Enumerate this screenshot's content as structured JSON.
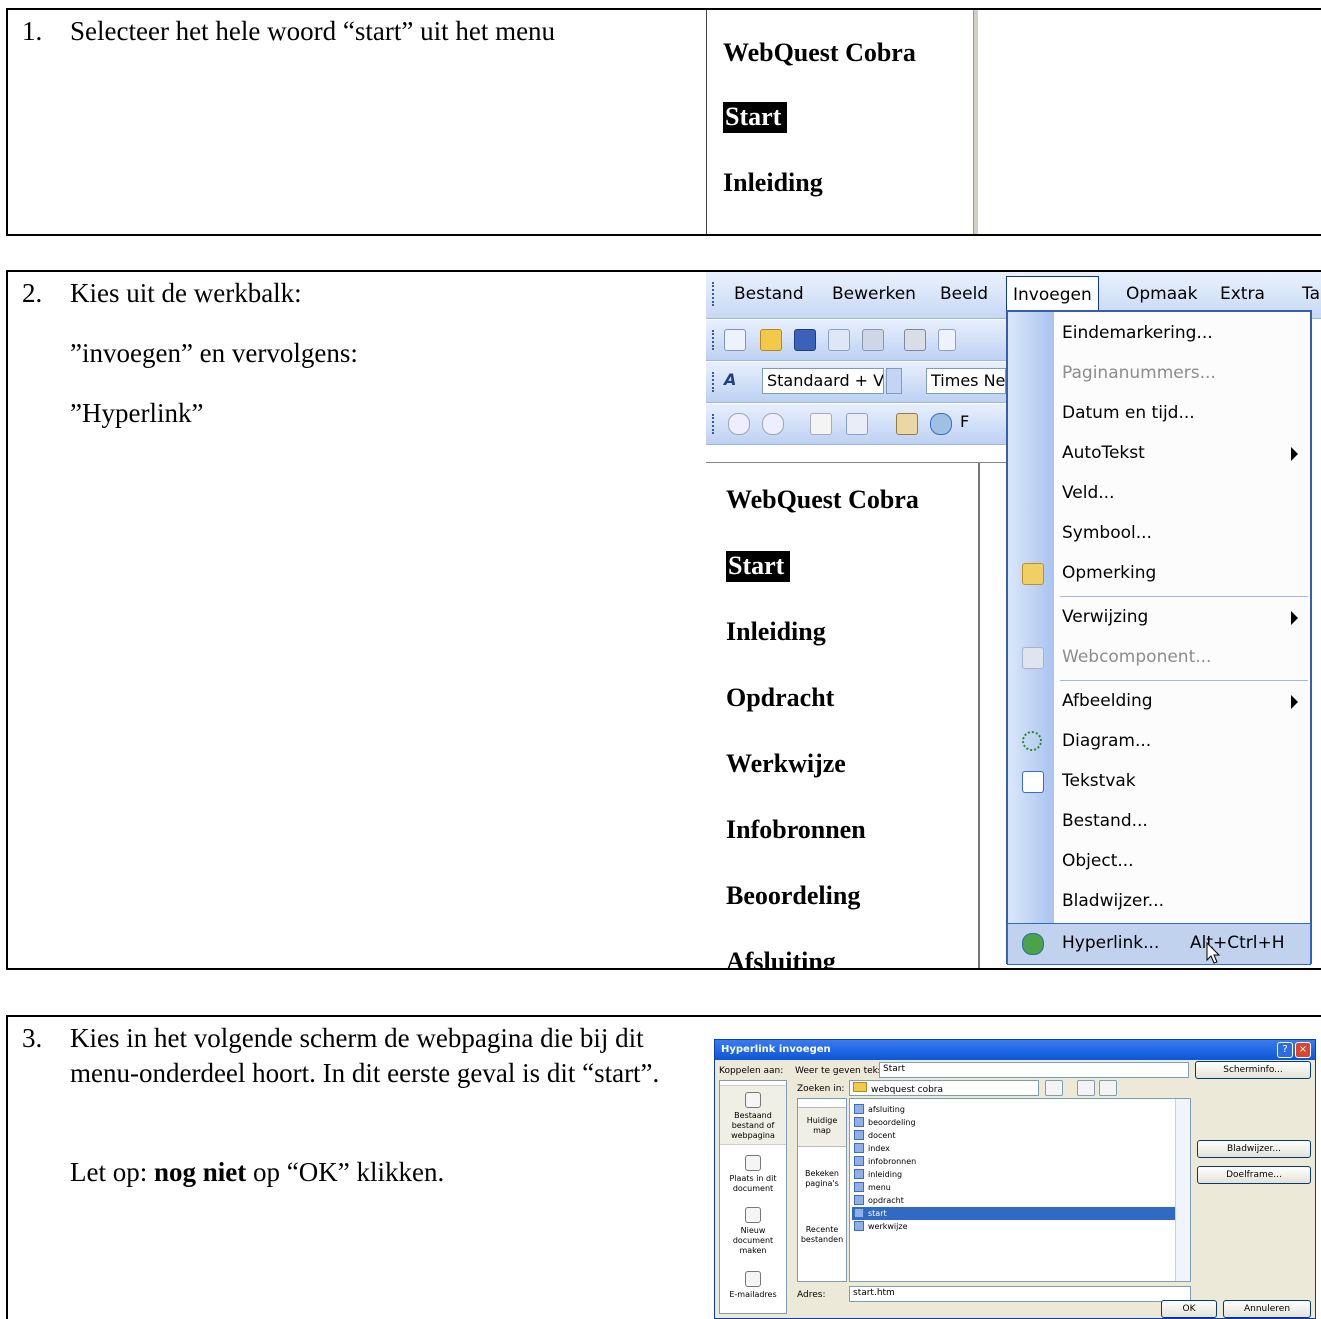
{
  "step1": {
    "number": "1.",
    "instruction": "Selecteer het hele woord “start” uit het menu",
    "menu_items": [
      "WebQuest Cobra",
      "Start",
      "Inleiding"
    ]
  },
  "step2": {
    "number": "2.",
    "line1": "Kies uit de werkbalk:",
    "line2": "”invoegen” en vervolgens:",
    "line3": "”Hyperlink”",
    "menubar": [
      "Bestand",
      "Bewerken",
      "Beeld",
      "Invoegen",
      "Opmaak",
      "Extra",
      "Ta"
    ],
    "style_box": "Standaard + Ve",
    "font_box": "Times Ne",
    "toolbar_letter": "F",
    "doc_items": [
      "WebQuest Cobra",
      "Start",
      "Inleiding",
      "Opdracht",
      "Werkwijze",
      "Infobronnen",
      "Beoordeling",
      "Afsluiting"
    ],
    "dropdown": [
      {
        "label": "Eindemarkering...",
        "disabled": false
      },
      {
        "label": "Paginanummers...",
        "disabled": true
      },
      {
        "label": "Datum en tijd...",
        "disabled": false
      },
      {
        "label": "AutoTekst",
        "disabled": false,
        "submenu": true
      },
      {
        "label": "Veld...",
        "disabled": false
      },
      {
        "label": "Symbool...",
        "disabled": false
      },
      {
        "label": "Opmerking",
        "disabled": false,
        "icon": "comment-icon"
      },
      {
        "label": "Verwijzing",
        "disabled": false,
        "submenu": true
      },
      {
        "label": "Webcomponent...",
        "disabled": true,
        "icon": "web-component-icon"
      },
      {
        "label": "Afbeelding",
        "disabled": false,
        "submenu": true
      },
      {
        "label": "Diagram...",
        "disabled": false,
        "icon": "diagram-icon"
      },
      {
        "label": "Tekstvak",
        "disabled": false,
        "icon": "textbox-icon"
      },
      {
        "label": "Bestand...",
        "disabled": false
      },
      {
        "label": "Object...",
        "disabled": false
      },
      {
        "label": "Bladwijzer...",
        "disabled": false
      },
      {
        "label": "Hyperlink...",
        "disabled": false,
        "shortcut": "Alt+Ctrl+H",
        "icon": "hyperlink-globe-icon"
      }
    ]
  },
  "step3": {
    "number": "3.",
    "para1": "Kies in het volgende scherm de webpagina die bij dit menu-onderdeel hoort. In dit eerste geval is dit “start”.",
    "para2_pre": "Let op: ",
    "para2_bold": "nog niet",
    "para2_post": " op “OK” klikken.",
    "dialog": {
      "title": "Hyperlink invoegen",
      "link_to_label": "Koppelen aan:",
      "display_text_label": "Weer te geven tekst:",
      "display_text_value": "Start",
      "screentip_button": "Scherminfo...",
      "look_in_label": "Zoeken in:",
      "look_in_value": "webquest cobra",
      "side": [
        "Bestaand bestand of webpagina",
        "Plaats in dit document",
        "Nieuw document maken",
        "E-mailadres"
      ],
      "look_side": [
        "Huidige map",
        "Bekeken pagina's",
        "Recente bestanden"
      ],
      "files": [
        "afsluiting",
        "beoordeling",
        "docent",
        "index",
        "infobronnen",
        "inleiding",
        "menu",
        "opdracht",
        "start",
        "werkwijze"
      ],
      "selected_file": "start",
      "bookmark_button": "Bladwijzer...",
      "target_frame_button": "Doelframe...",
      "address_label": "Adres:",
      "address_value": "start.htm",
      "ok_button": "OK",
      "cancel_button": "Annuleren"
    }
  }
}
